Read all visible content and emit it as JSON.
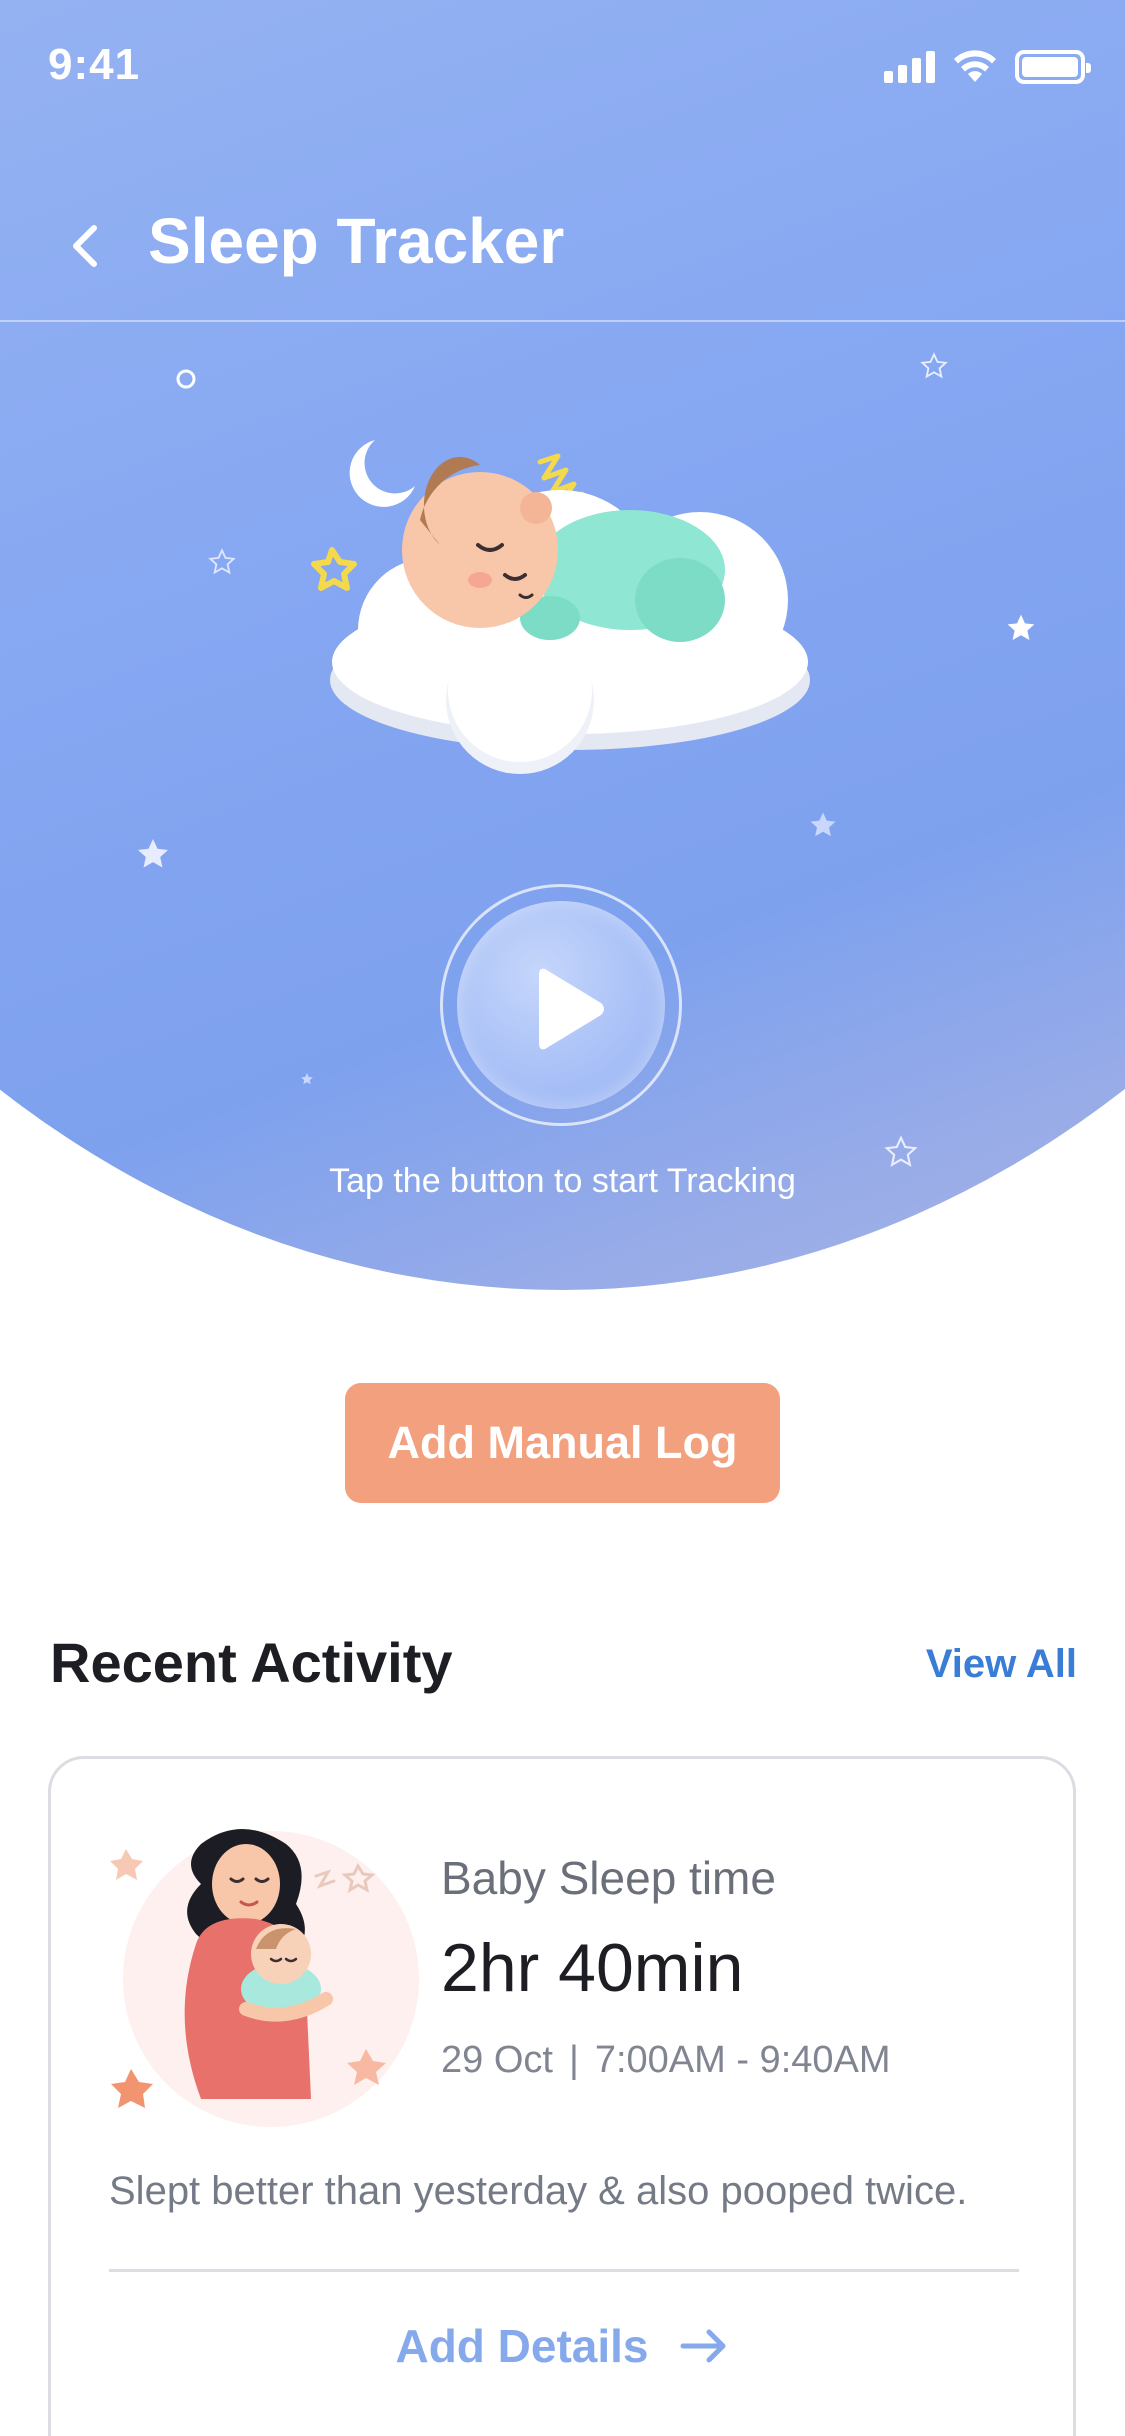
{
  "status_bar": {
    "time": "9:41"
  },
  "header": {
    "title": "Sleep Tracker"
  },
  "tracker": {
    "hint": "Tap the button to start Tracking"
  },
  "actions": {
    "manual_log_label": "Add Manual Log"
  },
  "recent": {
    "title": "Recent Activity",
    "view_all": "View All",
    "card": {
      "label": "Baby Sleep time",
      "duration": "2hr 40min",
      "date": "29 Oct",
      "time_range": "7:00AM - 9:40AM",
      "note": "Slept better than yesterday & also pooped twice.",
      "add_details": "Add Details"
    }
  },
  "colors": {
    "hero_gradient_start": "#94b2f2",
    "hero_gradient_end": "#7ea1ee",
    "cta": "#f2a07d",
    "link": "#3a7dd6",
    "add_details": "#86a9eb"
  },
  "icons": [
    "back-chevron-icon",
    "signal-icon",
    "wifi-icon",
    "battery-icon",
    "play-icon",
    "arrow-right-icon"
  ]
}
